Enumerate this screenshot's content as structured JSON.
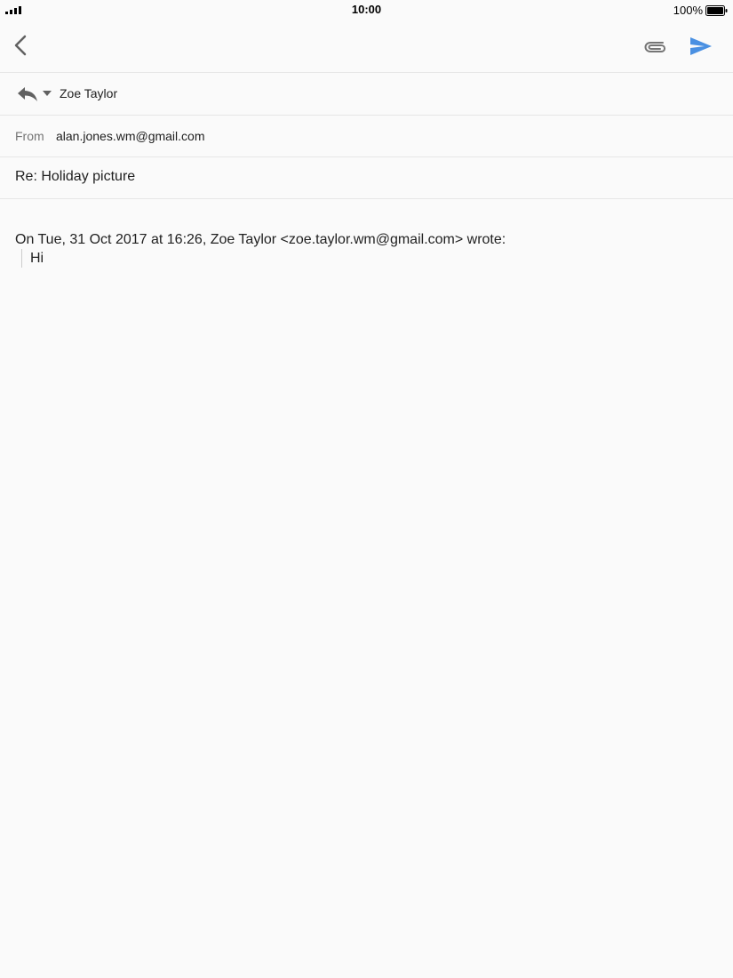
{
  "status_bar": {
    "time": "10:00",
    "battery_percent": "100%",
    "icons": [
      "signal-icon",
      "battery-icon"
    ]
  },
  "toolbar": {
    "icons": [
      "back-icon",
      "attachment-icon",
      "send-icon"
    ],
    "accent_color": "#4a90e2"
  },
  "compose": {
    "to_recipient": "Zoe Taylor",
    "from_label": "From",
    "from_value": "alan.jones.wm@gmail.com",
    "subject": "Re: Holiday picture",
    "quote_header": "On Tue, 31 Oct 2017 at 16:26, Zoe Taylor <zoe.taylor.wm@gmail.com> wrote:",
    "quoted_text": "Hi"
  }
}
